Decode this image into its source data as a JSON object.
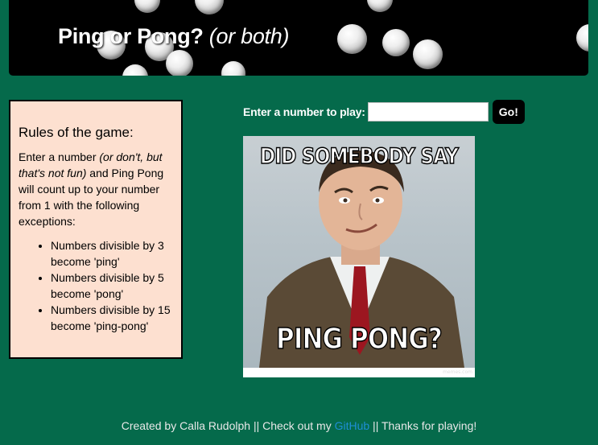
{
  "header": {
    "title_main": "Ping or Pong?",
    "title_sub": "(or both)"
  },
  "rules": {
    "heading": "Rules of the game:",
    "intro_before": "Enter a number ",
    "intro_italic": "(or don't, but that's not fun)",
    "intro_after": " and Ping Pong will count up to your number from 1 with the following exceptions:",
    "items": [
      "Numbers divisible by 3 become 'ping'",
      "Numbers divisible by 5 become 'pong'",
      "Numbers divisible by 15 become 'ping-pong'"
    ]
  },
  "form": {
    "label": "Enter a number to play:",
    "input_value": "",
    "button_label": "Go!"
  },
  "meme": {
    "top_text": "DID SOMEBODY SAY",
    "bottom_text": "PING PONG?",
    "watermark": "memes.com"
  },
  "footer": {
    "text_before": "Created by Calla Rudolph || Check out my ",
    "link_text": "GitHub",
    "text_after": " || Thanks for playing!"
  },
  "colors": {
    "background": "#056a4b",
    "rules_box": "#fde0d0",
    "link": "#1e8fd6"
  }
}
